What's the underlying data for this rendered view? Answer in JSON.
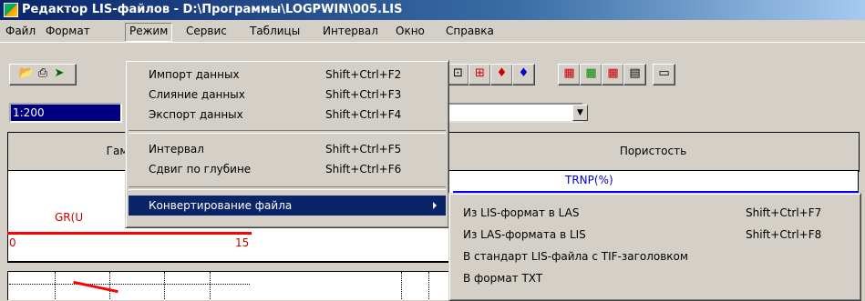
{
  "window": {
    "title": "Редактор LIS-файлов - D:\\Программы\\LOGPWIN\\005.LIS"
  },
  "menubar": {
    "items": [
      "Файл",
      "Формат",
      "Режим",
      "Сервис",
      "Таблицы",
      "Интервал",
      "Окно",
      "Справка"
    ],
    "active_index": 2
  },
  "toolbar": {
    "scale_value": "1:200",
    "icons": [
      "open-folder-icon",
      "print-icon",
      "exit-icon",
      "step-icon",
      "select-icon",
      "curve-left-icon",
      "curve-right-icon",
      "table-icon",
      "add-table-icon",
      "remove-table-icon",
      "grid-icon",
      "calculator-icon"
    ]
  },
  "grid": {
    "header_left": "Гамма-А",
    "header_right": "Пористость",
    "curve_left": "GR(U",
    "curve_right": "TRNP(%)",
    "scale_min": "0",
    "scale_max": "15"
  },
  "mode_menu": {
    "items": [
      {
        "label": "Импорт данных",
        "shortcut": "Shift+Ctrl+F2"
      },
      {
        "label": "Слияние данных",
        "shortcut": "Shift+Ctrl+F3"
      },
      {
        "label": "Экспорт данных",
        "shortcut": "Shift+Ctrl+F4"
      },
      {
        "label": "Интервал",
        "shortcut": "Shift+Ctrl+F5"
      },
      {
        "label": "Сдвиг по глубине",
        "shortcut": "Shift+Ctrl+F6"
      },
      {
        "label": "Конвертирование файла",
        "shortcut": ""
      }
    ],
    "highlighted": "Конвертирование файла"
  },
  "convert_submenu": {
    "items": [
      {
        "label": "Из LIS-формат в LAS",
        "shortcut": "Shift+Ctrl+F7"
      },
      {
        "label": "Из LAS-формата в LIS",
        "shortcut": "Shift+Ctrl+F8"
      },
      {
        "label": "В стандарт LIS-файла с TIF-заголовком",
        "shortcut": ""
      },
      {
        "label": "В формат TXT",
        "shortcut": ""
      }
    ]
  },
  "colors": {
    "title_bar": "#0a246a",
    "highlight": "#0a246a",
    "curve_red": "#ff0000",
    "curve_blue": "#0000ff"
  }
}
